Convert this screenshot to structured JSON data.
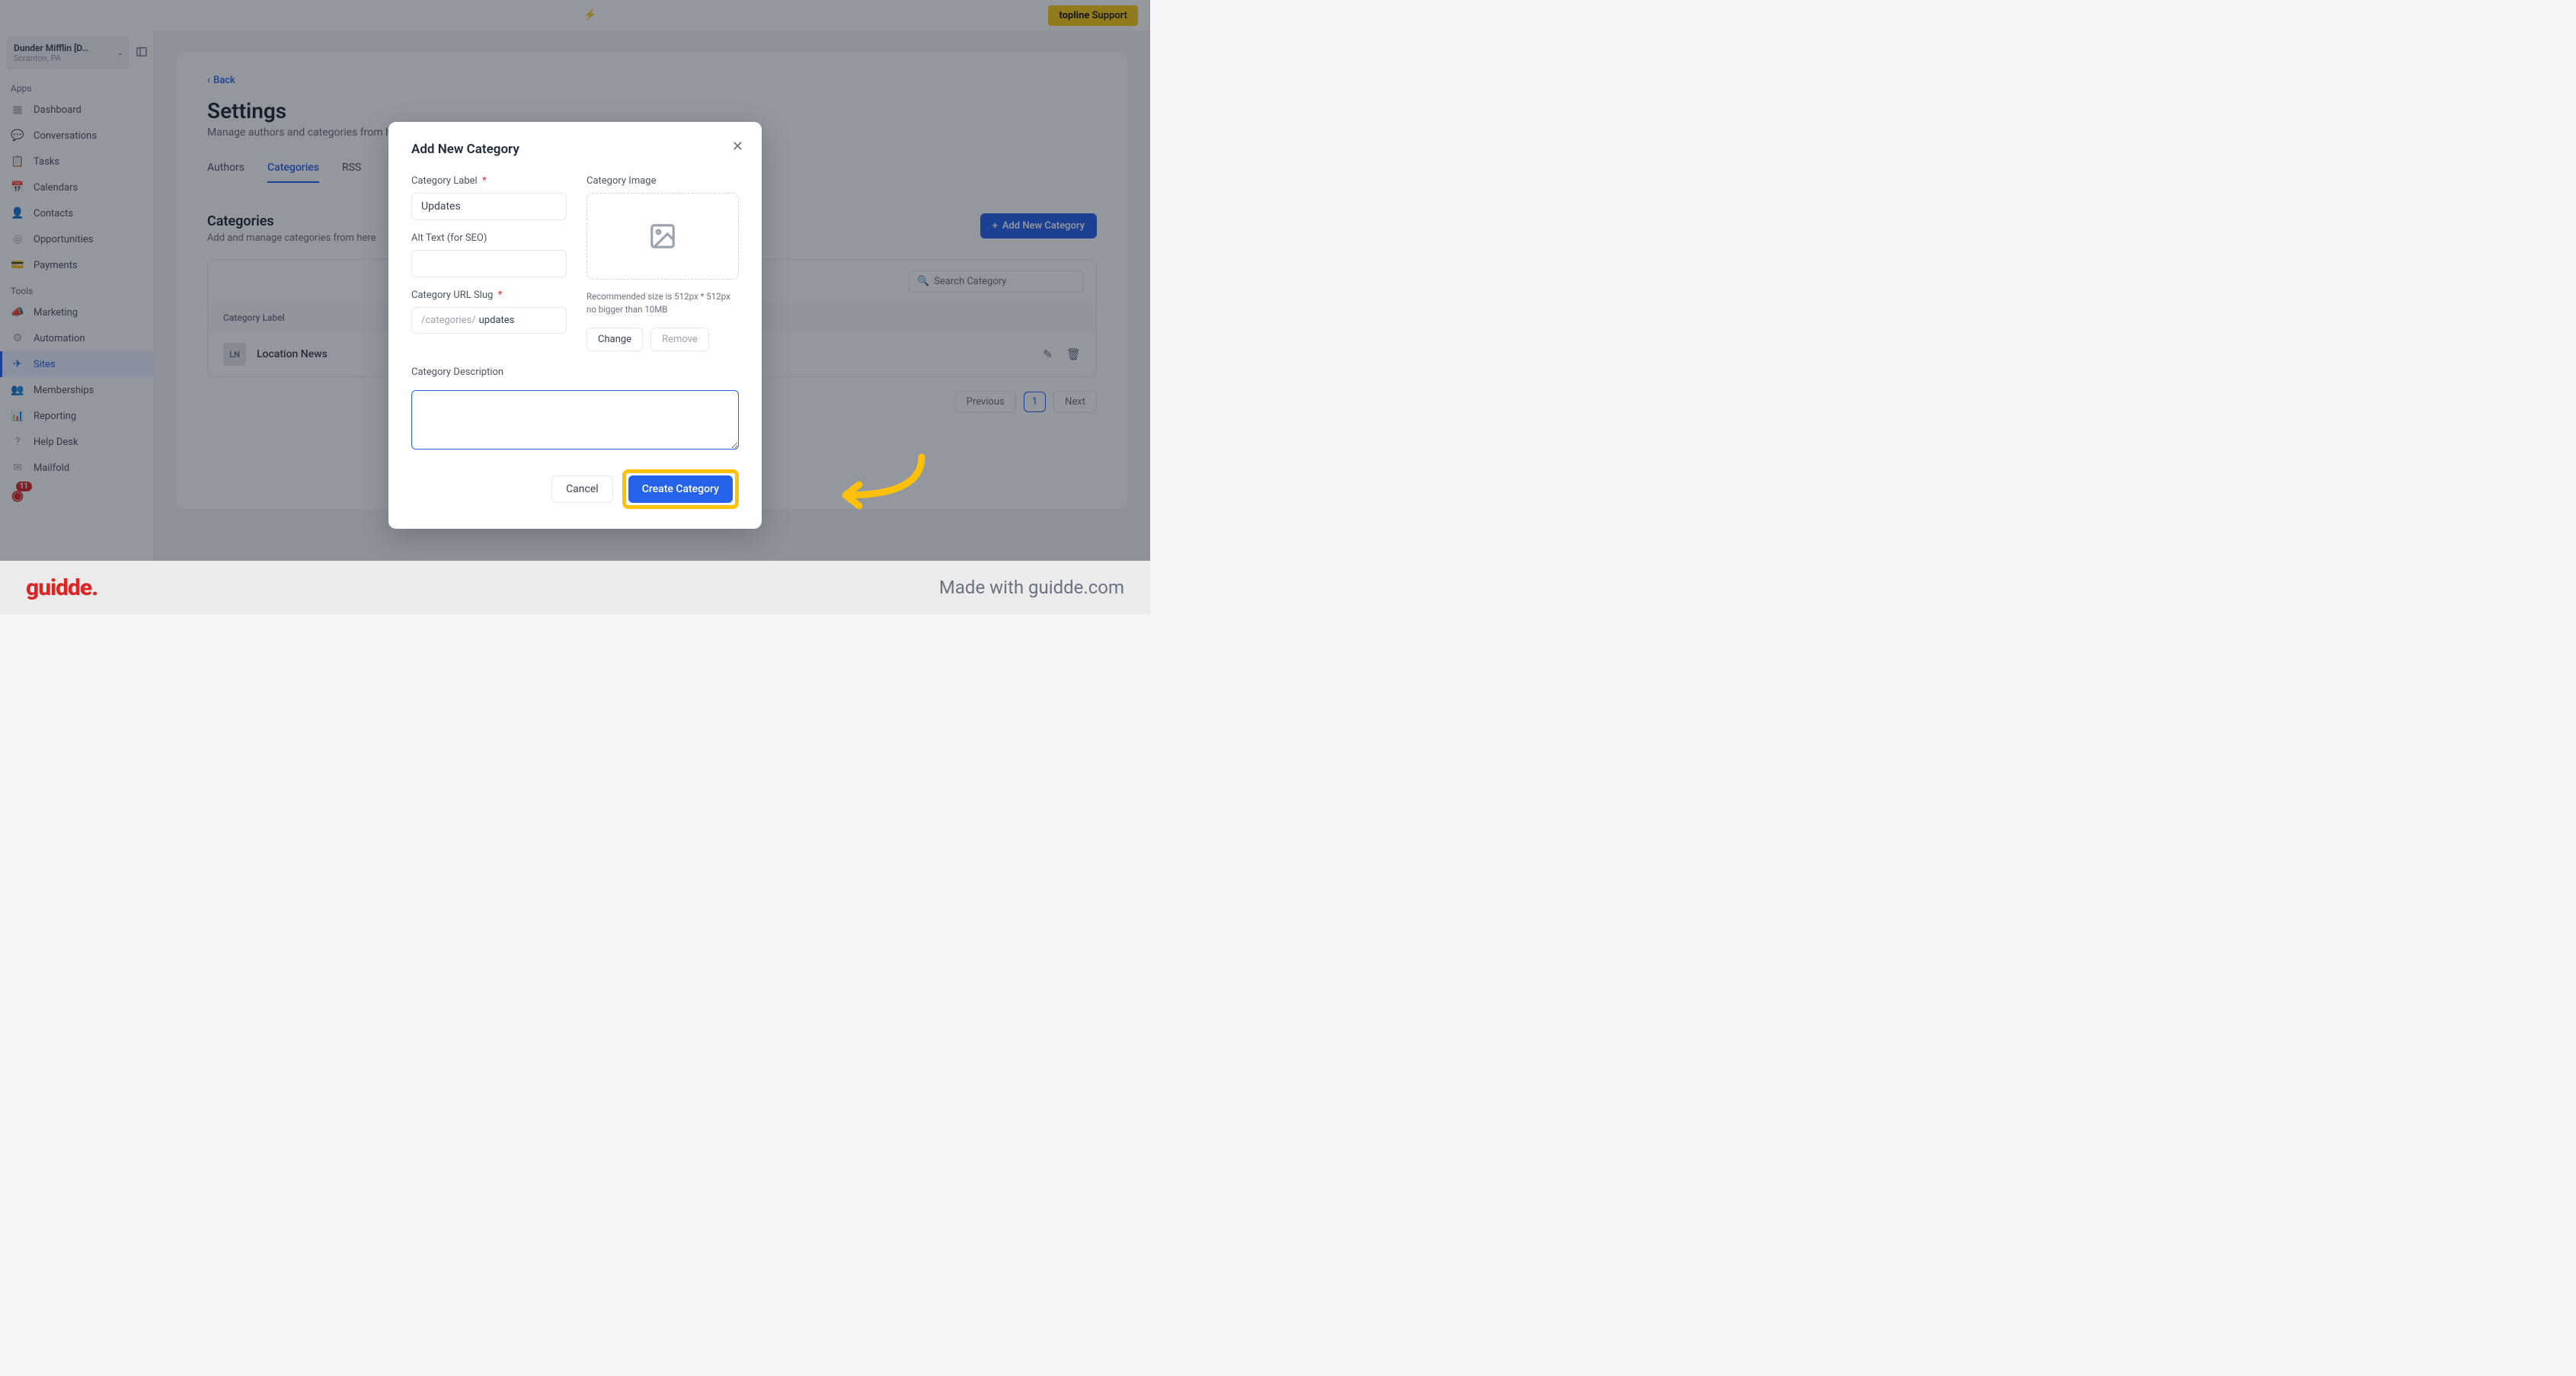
{
  "topbar": {
    "center_hint": "",
    "support_label": "topline Support"
  },
  "account": {
    "name": "Dunder Mifflin [D…",
    "location": "Scranton, PA"
  },
  "sidebar": {
    "apps_label": "Apps",
    "tools_label": "Tools",
    "apps": [
      {
        "label": "Dashboard",
        "icon": "▦"
      },
      {
        "label": "Conversations",
        "icon": "💬"
      },
      {
        "label": "Tasks",
        "icon": "📋"
      },
      {
        "label": "Calendars",
        "icon": "📅"
      },
      {
        "label": "Contacts",
        "icon": "👤"
      },
      {
        "label": "Opportunities",
        "icon": "◎"
      },
      {
        "label": "Payments",
        "icon": "💳"
      }
    ],
    "tools": [
      {
        "label": "Marketing",
        "icon": "📣"
      },
      {
        "label": "Automation",
        "icon": "⚙"
      },
      {
        "label": "Sites",
        "icon": "✈",
        "active": true
      },
      {
        "label": "Memberships",
        "icon": "👥"
      },
      {
        "label": "Reporting",
        "icon": "📊"
      },
      {
        "label": "Help Desk",
        "icon": "?"
      },
      {
        "label": "Mailfold",
        "icon": "✉"
      }
    ],
    "badge_count": "11"
  },
  "page": {
    "back": "Back",
    "title": "Settings",
    "subtitle": "Manage authors and categories from here",
    "tabs": [
      "Authors",
      "Categories",
      "RSS"
    ],
    "active_tab": 1,
    "section_title": "Categories",
    "section_sub": "Add and manage categories from here",
    "add_btn": "Add New Category",
    "search_placeholder": "Search Category",
    "table_header": "Category Label",
    "rows": [
      {
        "avatar": "LN",
        "label": "Location News"
      }
    ],
    "prev": "Previous",
    "next": "Next",
    "page_num": "1"
  },
  "modal": {
    "title": "Add New Category",
    "label_field": "Category Label",
    "label_value": "Updates",
    "alt_field": "Alt Text (for SEO)",
    "slug_field": "Category URL Slug",
    "slug_prefix": "/categories/",
    "slug_value": "updates",
    "image_field": "Category Image",
    "image_note": "Recommended size is 512px * 512px no bigger than 10MB",
    "change": "Change",
    "remove": "Remove",
    "desc_field": "Category Description",
    "cancel": "Cancel",
    "create": "Create Category"
  },
  "footer": {
    "logo": "guidde",
    "made": "Made with guidde.com"
  }
}
